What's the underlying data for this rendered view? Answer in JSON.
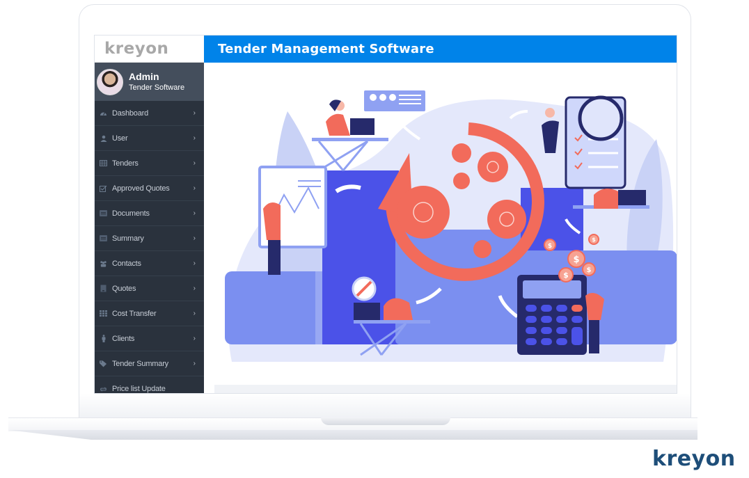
{
  "app": {
    "brand": "kreyon",
    "page_title": "Tender Management Software"
  },
  "profile": {
    "name": "Admin",
    "role": "Tender Software"
  },
  "sidebar": {
    "items": [
      {
        "label": "Dashboard",
        "icon": "dashboard-icon",
        "has_chevron": true
      },
      {
        "label": "User",
        "icon": "user-icon",
        "has_chevron": true
      },
      {
        "label": "Tenders",
        "icon": "table-icon",
        "has_chevron": true
      },
      {
        "label": "Approved Quotes",
        "icon": "checkbox-icon",
        "has_chevron": true
      },
      {
        "label": "Documents",
        "icon": "document-icon",
        "has_chevron": true
      },
      {
        "label": "Summary",
        "icon": "summary-icon",
        "has_chevron": true
      },
      {
        "label": "Contacts",
        "icon": "users-icon",
        "has_chevron": true
      },
      {
        "label": "Quotes",
        "icon": "quote-icon",
        "has_chevron": true
      },
      {
        "label": "Cost Transfer",
        "icon": "grid-icon",
        "has_chevron": true
      },
      {
        "label": "Clients",
        "icon": "client-icon",
        "has_chevron": true
      },
      {
        "label": "Tender Summary",
        "icon": "tag-icon",
        "has_chevron": true
      },
      {
        "label": "Price list Update",
        "icon": "refresh-icon",
        "has_chevron": false
      }
    ]
  },
  "illustration": {
    "subject": "team managing tenders: gears cycle, charts, checklist, calculator with dollar coins",
    "colors": {
      "primary_blue": "#4b52e8",
      "light_blue": "#7f95ee",
      "pale_blue": "#dfe4fa",
      "coral": "#f26b5b",
      "navy": "#262a6b"
    }
  },
  "footer_brand": "kreyon",
  "colors": {
    "header_blue": "#0083e9",
    "sidebar_bg": "#2a323d",
    "profile_bg": "#444e5c",
    "footer_brand": "#1e4e79"
  }
}
